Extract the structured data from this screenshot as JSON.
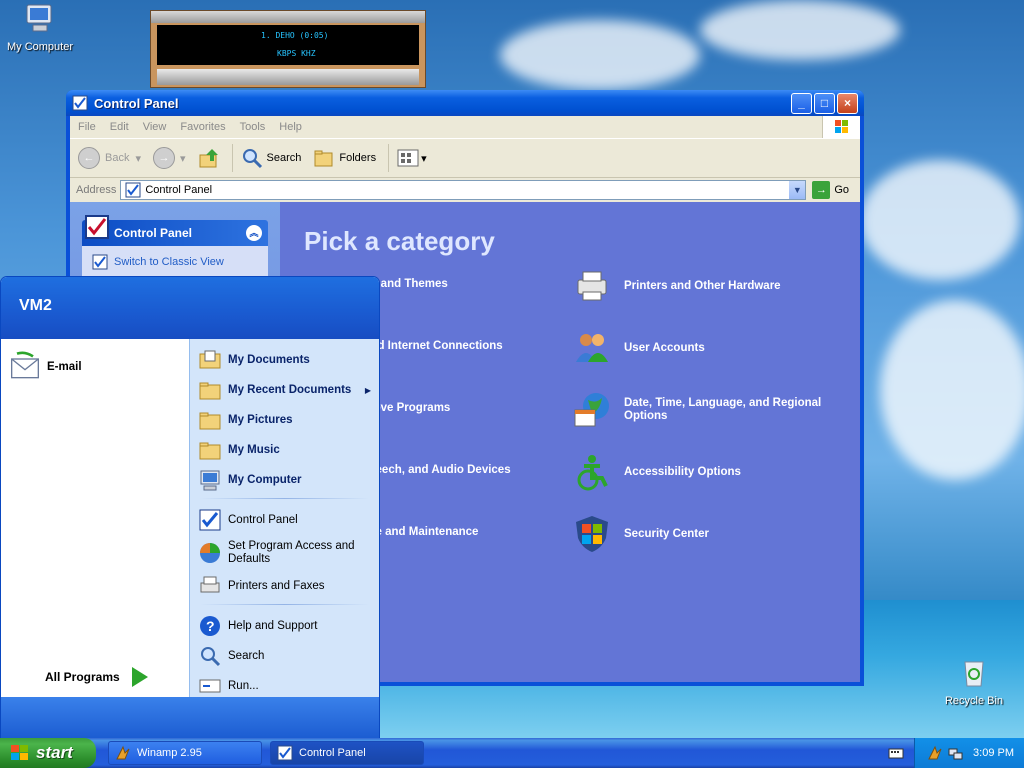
{
  "desktop": {
    "icons": [
      {
        "label": "My Computer"
      },
      {
        "label": "Recycle Bin"
      }
    ]
  },
  "winamp": {
    "line1": "1. DEHO (0:05)",
    "line2": "KBPS      KHZ"
  },
  "window": {
    "title": "Control Panel",
    "menu": [
      "File",
      "Edit",
      "View",
      "Favorites",
      "Tools",
      "Help"
    ],
    "toolbar": {
      "back": "Back",
      "search": "Search",
      "folders": "Folders"
    },
    "address": {
      "label": "Address",
      "value": "Control Panel",
      "go": "Go"
    },
    "task_pane": {
      "header": "Control Panel",
      "link": "Switch to Classic View"
    },
    "main": {
      "title": "Pick a category",
      "categories": [
        {
          "label": "earance and Themes"
        },
        {
          "label": "Printers and Other Hardware"
        },
        {
          "label": "work and Internet Connections"
        },
        {
          "label": "User Accounts"
        },
        {
          "label": "or Remove Programs"
        },
        {
          "label": "Date, Time, Language, and Regional Options"
        },
        {
          "label": "nds, Speech, and Audio Devices"
        },
        {
          "label": "Accessibility Options"
        },
        {
          "label": "ormance and Maintenance"
        },
        {
          "label": "Security Center"
        }
      ]
    }
  },
  "start_menu": {
    "user": "VM2",
    "pinned": [
      {
        "label": "E-mail"
      }
    ],
    "all_programs": "All Programs",
    "right": [
      {
        "label": "My Documents"
      },
      {
        "label": "My Recent Documents"
      },
      {
        "label": "My Pictures"
      },
      {
        "label": "My Music"
      },
      {
        "label": "My Computer"
      },
      {
        "label": "Control Panel"
      },
      {
        "label": "Set Program Access and Defaults"
      },
      {
        "label": "Printers and Faxes"
      },
      {
        "label": "Help and Support"
      },
      {
        "label": "Search"
      },
      {
        "label": "Run..."
      }
    ]
  },
  "taskbar": {
    "start": "start",
    "buttons": [
      {
        "label": "Winamp 2.95"
      },
      {
        "label": "Control Panel"
      }
    ],
    "clock": "3:09 PM"
  },
  "colors": {
    "xp_blue": "#0a50d8",
    "cp_background": "#6375d6",
    "start_green": "#2d8f2d",
    "startmenu_right": "#d3e5fa"
  }
}
